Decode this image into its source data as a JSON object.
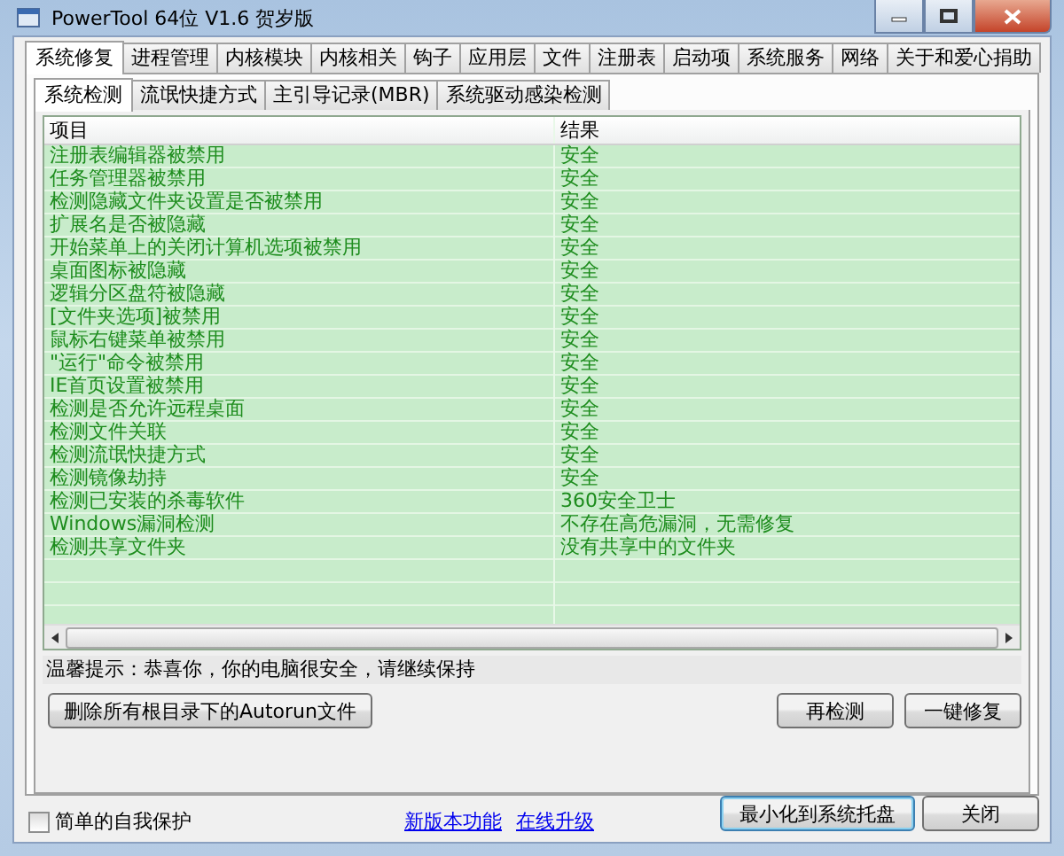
{
  "window": {
    "title": "PowerTool 64位 V1.6 贺岁版"
  },
  "tabs": [
    {
      "label": "系统修复",
      "selected": true
    },
    {
      "label": "进程管理",
      "selected": false
    },
    {
      "label": "内核模块",
      "selected": false
    },
    {
      "label": "内核相关",
      "selected": false
    },
    {
      "label": "钩子",
      "selected": false
    },
    {
      "label": "应用层",
      "selected": false
    },
    {
      "label": "文件",
      "selected": false
    },
    {
      "label": "注册表",
      "selected": false
    },
    {
      "label": "启动项",
      "selected": false
    },
    {
      "label": "系统服务",
      "selected": false
    },
    {
      "label": "网络",
      "selected": false
    },
    {
      "label": "关于和爱心捐助",
      "selected": false
    }
  ],
  "sub_tabs": [
    {
      "label": "系统检测",
      "selected": true
    },
    {
      "label": "流氓快捷方式",
      "selected": false
    },
    {
      "label": "主引导记录(MBR)",
      "selected": false
    },
    {
      "label": "系统驱动感染检测",
      "selected": false
    }
  ],
  "table": {
    "columns": [
      "项目",
      "结果"
    ],
    "rows": [
      {
        "item": "注册表编辑器被禁用",
        "result": "安全"
      },
      {
        "item": "任务管理器被禁用",
        "result": "安全"
      },
      {
        "item": "检测隐藏文件夹设置是否被禁用",
        "result": "安全"
      },
      {
        "item": "扩展名是否被隐藏",
        "result": "安全"
      },
      {
        "item": "开始菜单上的关闭计算机选项被禁用",
        "result": "安全"
      },
      {
        "item": "桌面图标被隐藏",
        "result": "安全"
      },
      {
        "item": "逻辑分区盘符被隐藏",
        "result": "安全"
      },
      {
        "item": "[文件夹选项]被禁用",
        "result": "安全"
      },
      {
        "item": "鼠标右键菜单被禁用",
        "result": "安全"
      },
      {
        "item": "\"运行\"命令被禁用",
        "result": "安全"
      },
      {
        "item": "IE首页设置被禁用",
        "result": "安全"
      },
      {
        "item": "检测是否允许远程桌面",
        "result": "安全"
      },
      {
        "item": "检测文件关联",
        "result": "安全"
      },
      {
        "item": "检测流氓快捷方式",
        "result": "安全"
      },
      {
        "item": "检测镜像劫持",
        "result": "安全"
      },
      {
        "item": "检测已安装的杀毒软件",
        "result": "360安全卫士"
      },
      {
        "item": "Windows漏洞检测",
        "result": "不存在高危漏洞，无需修复"
      },
      {
        "item": "检测共享文件夹",
        "result": "没有共享中的文件夹"
      }
    ]
  },
  "tip": "温馨提示：恭喜你，你的电脑很安全，请继续保持",
  "actions": [
    "删除所有根目录下的Autorun文件",
    "再检测",
    "一键修复"
  ],
  "self_protect": {
    "label": "简单的自我保护",
    "checked": false
  },
  "links": [
    "新版本功能",
    "在线升级"
  ],
  "bottom_buttons": [
    "最小化到系统托盘",
    "关闭"
  ]
}
